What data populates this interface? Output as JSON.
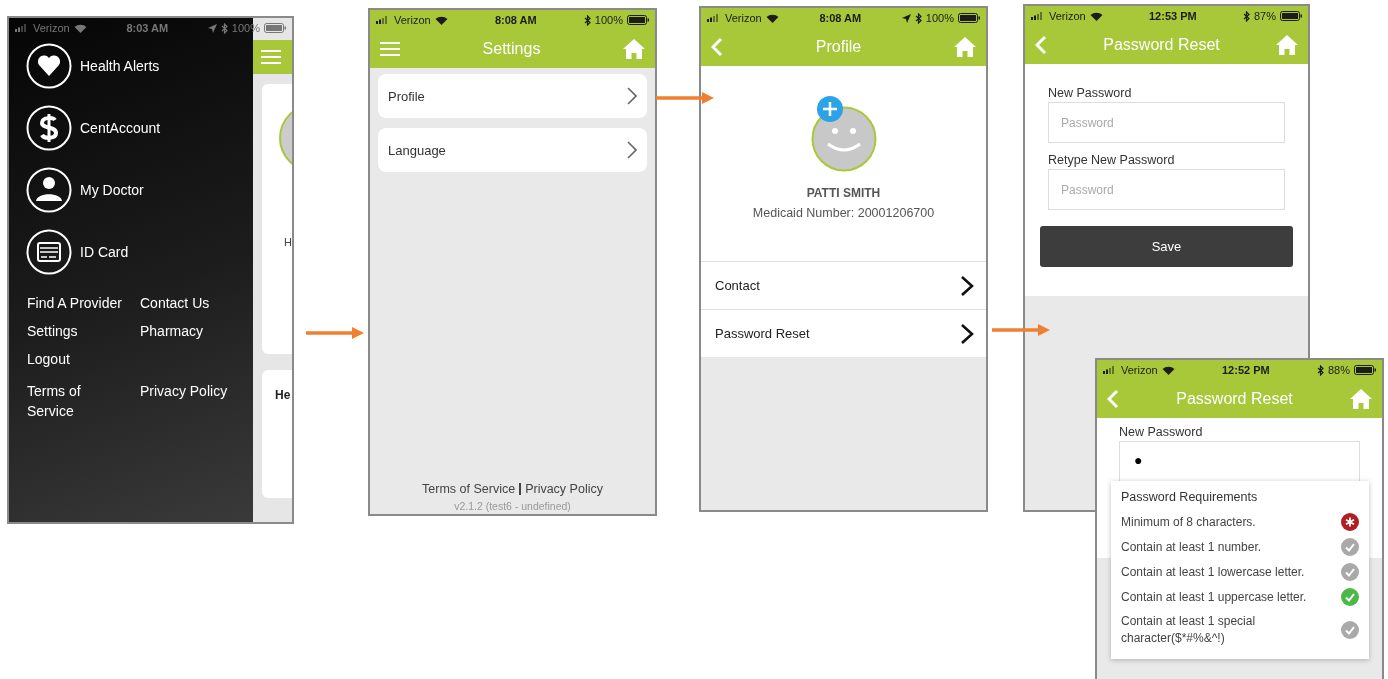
{
  "menu_screen": {
    "status_bar": {
      "carrier": "Verizon",
      "time": "8:03 AM",
      "battery": "100%",
      "location": true
    },
    "menu_items": [
      {
        "label": "Health Alerts"
      },
      {
        "label": "CentAccount"
      },
      {
        "label": "My Doctor"
      },
      {
        "label": "ID Card"
      }
    ],
    "link_rows": [
      [
        "Find A Provider",
        "Contact Us"
      ],
      [
        "Settings",
        "Pharmacy"
      ],
      [
        "Logout"
      ],
      [
        "Terms of Service",
        "Privacy Policy"
      ]
    ],
    "background_cards": [
      "H",
      "He"
    ]
  },
  "settings_screen": {
    "status_bar": {
      "carrier": "Verizon",
      "time": "8:08 AM",
      "battery": "100%",
      "location": false
    },
    "header": {
      "kind": "menu",
      "title": "Settings"
    },
    "items": [
      {
        "label": "Profile"
      },
      {
        "label": "Language"
      }
    ],
    "footer_links": [
      "Terms of Service",
      "Privacy Policy"
    ],
    "version": "v2.1.2 (test6 - undefined)"
  },
  "profile_screen": {
    "status_bar": {
      "carrier": "Verizon",
      "time": "8:08 AM",
      "battery": "100%",
      "location": true
    },
    "header": {
      "kind": "back",
      "title": "Profile"
    },
    "name": "PATTI SMITH",
    "medicaid_number": "Medicaid Number: 20001206700",
    "items": [
      {
        "label": "Contact"
      },
      {
        "label": "Password Reset"
      }
    ]
  },
  "password_screen": {
    "status_bar": {
      "carrier": "Verizon",
      "time": "12:53 PM",
      "battery": "87%",
      "location": false
    },
    "header": {
      "kind": "back",
      "title": "Password Reset"
    },
    "fields": [
      {
        "label": "New Password",
        "placeholder": "Password"
      },
      {
        "label": "Retype New Password",
        "placeholder": "Password"
      }
    ],
    "save_button": "Save"
  },
  "password_popup_screen": {
    "status_bar": {
      "carrier": "Verizon",
      "time": "12:52 PM",
      "battery": "88%",
      "location": false
    },
    "header": {
      "kind": "back",
      "title": "Password Reset"
    },
    "field": {
      "label": "New Password",
      "value": "●"
    },
    "requirements_title": "Password Requirements",
    "requirements": [
      {
        "text": "Minimum of 8 characters.",
        "error": true,
        "met": false
      },
      {
        "text": "Contain at least 1 number.",
        "error": false,
        "met": false
      },
      {
        "text": "Contain at least 1 lowercase letter.",
        "error": false,
        "met": false
      },
      {
        "text": "Contain at least 1 uppercase letter.",
        "error": false,
        "met": true
      },
      {
        "text": "Contain at least 1 special character($*#%&^!)",
        "error": false,
        "met": false
      }
    ]
  }
}
